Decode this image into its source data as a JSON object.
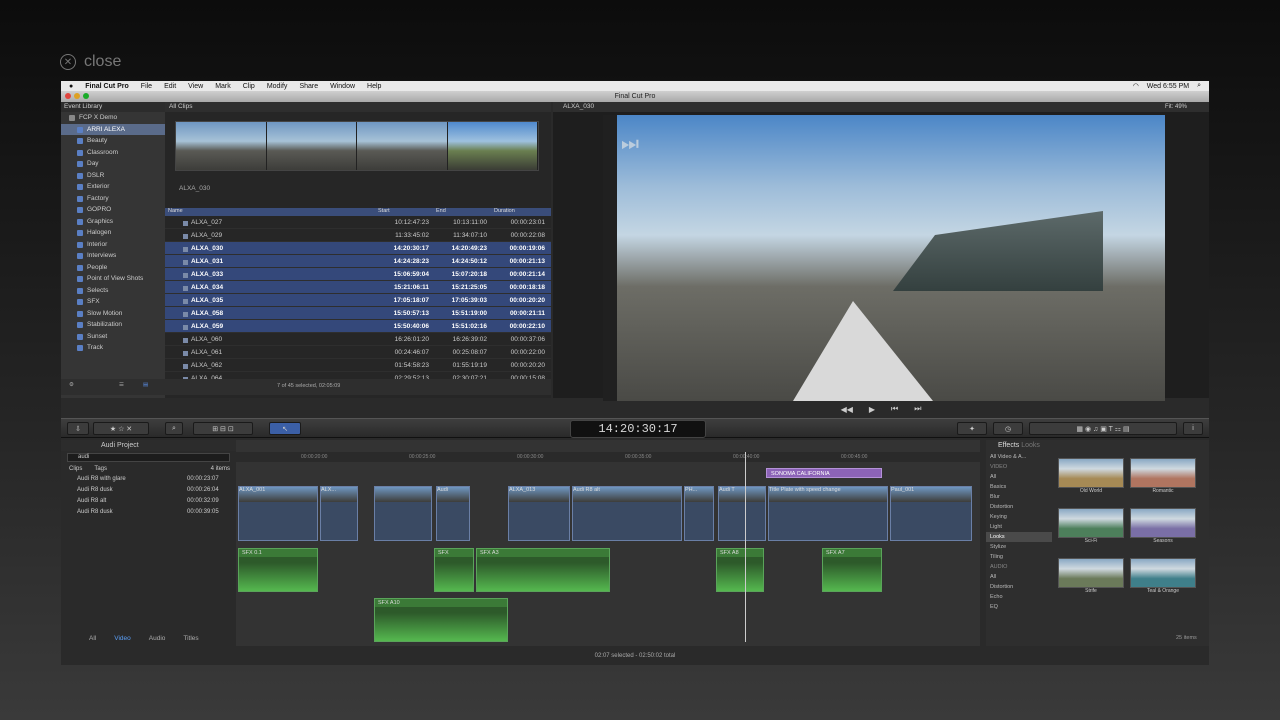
{
  "overlay": {
    "close_label": "close"
  },
  "menubar": {
    "app_name": "Final Cut Pro",
    "menus": [
      "File",
      "Edit",
      "View",
      "Mark",
      "Clip",
      "Modify",
      "Share",
      "Window",
      "Help"
    ],
    "clock": "Wed 6:55 PM"
  },
  "window": {
    "title": "Final Cut Pro"
  },
  "library": {
    "title": "Event Library",
    "items": [
      {
        "label": "FCP X Demo",
        "level": "top",
        "selected": false
      },
      {
        "label": "ARRI ALEXA",
        "selected": true
      },
      {
        "label": "Beauty"
      },
      {
        "label": "Classroom"
      },
      {
        "label": "Day"
      },
      {
        "label": "DSLR"
      },
      {
        "label": "Exterior"
      },
      {
        "label": "Factory"
      },
      {
        "label": "GOPRO"
      },
      {
        "label": "Graphics"
      },
      {
        "label": "Halogen"
      },
      {
        "label": "Interior"
      },
      {
        "label": "Interviews"
      },
      {
        "label": "People"
      },
      {
        "label": "Point of View Shots"
      },
      {
        "label": "Selects"
      },
      {
        "label": "SFX"
      },
      {
        "label": "Slow Motion"
      },
      {
        "label": "Stabilization"
      },
      {
        "label": "Sunset"
      },
      {
        "label": "Track"
      }
    ]
  },
  "browser": {
    "title": "All Clips",
    "filmstrip_label": "ALXA_030",
    "columns": [
      "Name",
      "Start",
      "End",
      "Duration"
    ],
    "rows": [
      {
        "name": "ALXA_027",
        "start": "10:12:47:23",
        "end": "10:13:11:00",
        "dur": "00:00:23:01",
        "sel": false
      },
      {
        "name": "ALXA_029",
        "start": "11:33:45:02",
        "end": "11:34:07:10",
        "dur": "00:00:22:08",
        "sel": false
      },
      {
        "name": "ALXA_030",
        "start": "14:20:30:17",
        "end": "14:20:49:23",
        "dur": "00:00:19:06",
        "sel": true
      },
      {
        "name": "ALXA_031",
        "start": "14:24:28:23",
        "end": "14:24:50:12",
        "dur": "00:00:21:13",
        "sel": true
      },
      {
        "name": "ALXA_033",
        "start": "15:06:59:04",
        "end": "15:07:20:18",
        "dur": "00:00:21:14",
        "sel": true
      },
      {
        "name": "ALXA_034",
        "start": "15:21:06:11",
        "end": "15:21:25:05",
        "dur": "00:00:18:18",
        "sel": true
      },
      {
        "name": "ALXA_035",
        "start": "17:05:18:07",
        "end": "17:05:39:03",
        "dur": "00:00:20:20",
        "sel": true
      },
      {
        "name": "ALXA_058",
        "start": "15:50:57:13",
        "end": "15:51:19:00",
        "dur": "00:00:21:11",
        "sel": true
      },
      {
        "name": "ALXA_059",
        "start": "15:50:40:06",
        "end": "15:51:02:16",
        "dur": "00:00:22:10",
        "sel": true
      },
      {
        "name": "ALXA_060",
        "start": "16:26:01:20",
        "end": "16:26:39:02",
        "dur": "00:00:37:06",
        "sel": false
      },
      {
        "name": "ALXA_061",
        "start": "00:24:46:07",
        "end": "00:25:08:07",
        "dur": "00:00:22:00",
        "sel": false
      },
      {
        "name": "ALXA_062",
        "start": "01:54:58:23",
        "end": "01:55:19:19",
        "dur": "00:00:20:20",
        "sel": false
      },
      {
        "name": "ALXA_064",
        "start": "02:29:52:13",
        "end": "02:30:07:21",
        "dur": "00:00:15:08",
        "sel": false
      }
    ],
    "footer": "7 of 45 selected, 02:05:09"
  },
  "viewer": {
    "title": "ALXA_030",
    "fit": "Fit: 49%"
  },
  "toolbar": {
    "timecode": "14:20:30:17"
  },
  "timeline_index": {
    "project": "Audi Project",
    "search": "audi",
    "tabs_top": [
      "Clips",
      "Tags"
    ],
    "count": "4 items",
    "rows": [
      {
        "name": "Audi R8 with glare",
        "tc": "00:00:23:07"
      },
      {
        "name": "Audi R8 dusk",
        "tc": "00:00:26:04"
      },
      {
        "name": "Audi R8 alt",
        "tc": "00:00:32:09"
      },
      {
        "name": "Audi R8 dusk",
        "tc": "00:00:39:05"
      }
    ],
    "tabs": [
      "All",
      "Video",
      "Audio",
      "Titles"
    ]
  },
  "timeline": {
    "ruler": [
      "00:00:20:00",
      "00:00:25:00",
      "00:00:30:00",
      "00:00:35:00",
      "00:00:40:00",
      "00:00:45:00"
    ],
    "title_clip": "SONOMA CALIFORNIA",
    "video_clips": [
      "ALXA_001",
      "ALX...",
      "Audi",
      "ALXA_013",
      "Audi R8 alt",
      "PH...",
      "Audi T",
      "Title Plate with speed change",
      "Paul_001"
    ],
    "audio_clips": [
      "SFX 0.1",
      "SFX",
      "SFX A3",
      "SFX A8",
      "SFX A7",
      "SFX A10"
    ]
  },
  "effects": {
    "title": "Effects",
    "subtitle": "Looks",
    "categories": [
      "All Video & A...",
      "VIDEO",
      "All",
      "Basics",
      "Blur",
      "Distortion",
      "Keying",
      "Light",
      "Looks",
      "Stylize",
      "Tiling",
      "AUDIO",
      "All",
      "Distortion",
      "Echo",
      "EQ"
    ],
    "selected": "Looks",
    "items": [
      "Old World",
      "Romantic",
      "Sci-Fi",
      "Seasons",
      "Strife",
      "Teal & Orange"
    ],
    "count": "25 items"
  },
  "status": {
    "text": "02:07 selected - 02:50:02 total"
  }
}
